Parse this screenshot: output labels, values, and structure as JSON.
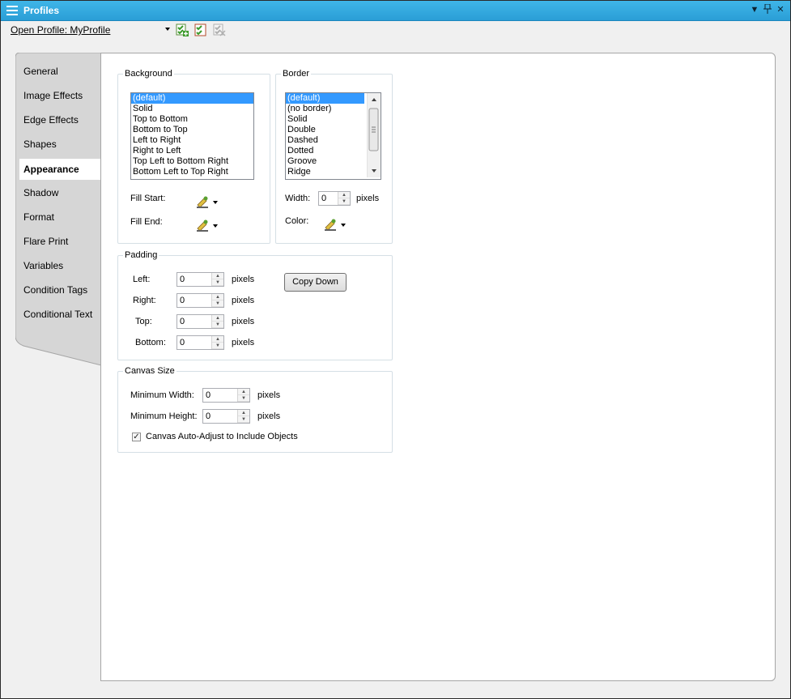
{
  "window": {
    "title": "Profiles"
  },
  "toolbar": {
    "open_profile": "Open Profile: MyProfile"
  },
  "tabs": [
    "General",
    "Image Effects",
    "Edge Effects",
    "Shapes",
    "Appearance",
    "Shadow",
    "Format",
    "Flare Print",
    "Variables",
    "Condition Tags",
    "Conditional Text"
  ],
  "active_tab": "Appearance",
  "background": {
    "legend": "Background",
    "items": [
      "(default)",
      "Solid",
      "Top to Bottom",
      "Bottom to Top",
      "Left to Right",
      "Right to Left",
      "Top Left to Bottom Right",
      "Bottom Left to Top Right"
    ],
    "selected": "(default)",
    "fill_start_label": "Fill Start:",
    "fill_end_label": "Fill End:"
  },
  "border": {
    "legend": "Border",
    "items": [
      "(default)",
      "(no border)",
      "Solid",
      "Double",
      "Dashed",
      "Dotted",
      "Groove",
      "Ridge"
    ],
    "selected": "(default)",
    "width_label": "Width:",
    "width_value": "0",
    "width_unit": "pixels",
    "color_label": "Color:"
  },
  "padding": {
    "legend": "Padding",
    "left_label": "Left:",
    "left_value": "0",
    "right_label": "Right:",
    "right_value": "0",
    "top_label": "Top:",
    "top_value": "0",
    "bottom_label": "Bottom:",
    "bottom_value": "0",
    "unit": "pixels",
    "copy_down": "Copy Down"
  },
  "canvas": {
    "legend": "Canvas Size",
    "min_width_label": "Minimum Width:",
    "min_width_value": "0",
    "min_height_label": "Minimum Height:",
    "min_height_value": "0",
    "unit": "pixels",
    "auto_adjust_label": "Canvas Auto-Adjust to Include Objects",
    "auto_adjust_checked": true
  },
  "colors": {
    "titlebar": "#2ea8e0",
    "selection": "#3399ff"
  }
}
